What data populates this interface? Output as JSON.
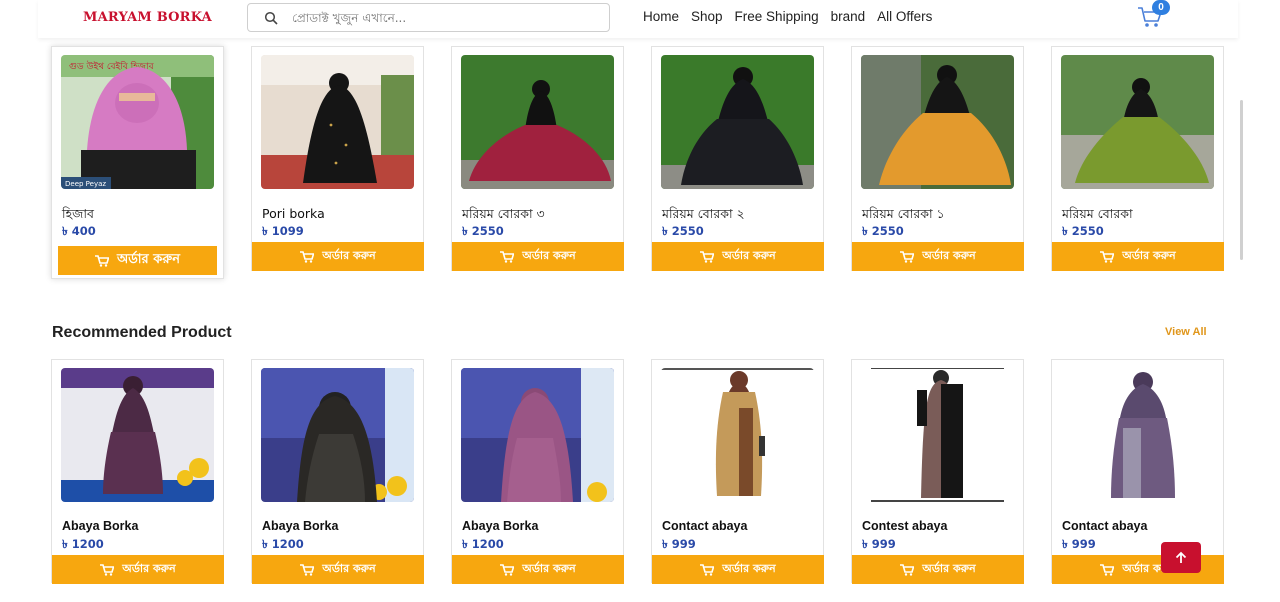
{
  "header": {
    "logo": "MARYAM BORKA",
    "search_placeholder": "প্রোডাক্ট খুজুন এখানে...",
    "nav": [
      "Home",
      "Shop",
      "Free Shipping",
      "brand",
      "All Offers"
    ],
    "cart_count": "0"
  },
  "top_products": [
    {
      "name": "হিজাব",
      "price": "৳ 400",
      "button": "অর্ডার করুন"
    },
    {
      "name": "Pori borka",
      "price": "৳ 1099",
      "button": "অর্ডার করুন"
    },
    {
      "name": "মরিয়ম বোরকা ৩",
      "price": "৳ 2550",
      "button": "অর্ডার করুন"
    },
    {
      "name": "মরিয়ম বোরকা ২",
      "price": "৳ 2550",
      "button": "অর্ডার করুন"
    },
    {
      "name": "মরিয়ম বোরকা ১",
      "price": "৳ 2550",
      "button": "অর্ডার করুন"
    },
    {
      "name": "মরিয়ম বোরকা",
      "price": "৳ 2550",
      "button": "অর্ডার করুন"
    }
  ],
  "recommended": {
    "title": "Recommended Product",
    "view_all": "View All",
    "products": [
      {
        "name": "Abaya Borka",
        "price": "৳ 1200",
        "button": "অর্ডার করুন"
      },
      {
        "name": "Abaya Borka",
        "price": "৳ 1200",
        "button": "অর্ডার করুন"
      },
      {
        "name": "Abaya Borka",
        "price": "৳ 1200",
        "button": "অর্ডার করুন"
      },
      {
        "name": "Contact abaya",
        "price": "৳ 999",
        "button": "অর্ডার করুন"
      },
      {
        "name": "Contest abaya",
        "price": "৳ 999",
        "button": "অর্ডার করুন"
      },
      {
        "name": "Contact abaya",
        "price": "৳ 999",
        "button": "অর্ডার করুন"
      }
    ]
  },
  "colors": {
    "brand": "#c8102e",
    "order_button": "#f7a70f",
    "price": "#2a4aa8",
    "view_all": "#e0961a"
  }
}
